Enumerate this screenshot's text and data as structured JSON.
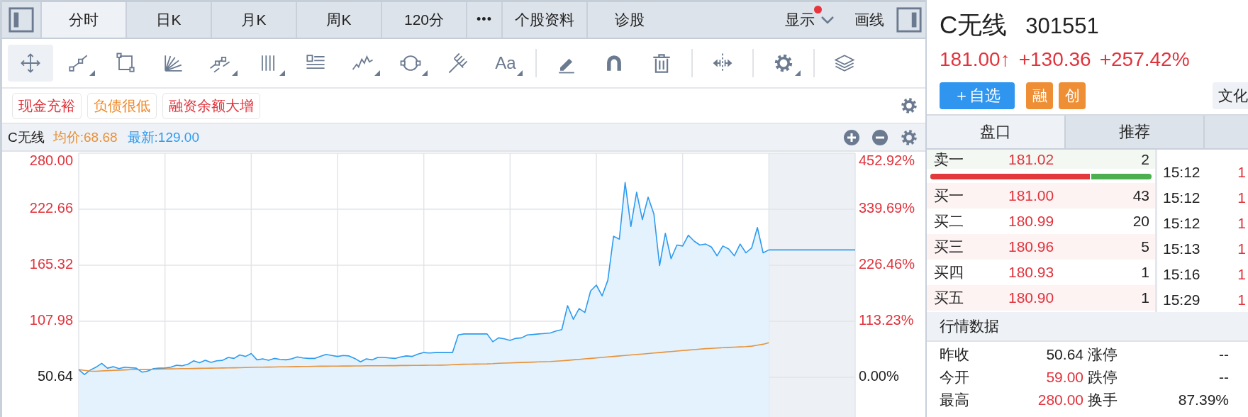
{
  "top_tabs": [
    {
      "label": "分时",
      "selected": true
    },
    {
      "label": "日K",
      "selected": false
    },
    {
      "label": "月K",
      "selected": false
    },
    {
      "label": "周K",
      "selected": false
    },
    {
      "label": "120分",
      "selected": false
    },
    {
      "label": "•••",
      "selected": false
    },
    {
      "label": "个股资料",
      "selected": false
    },
    {
      "label": "诊股",
      "selected": false
    }
  ],
  "display_menu": {
    "label": "显示",
    "notification": true
  },
  "draw_button": {
    "label": "画线"
  },
  "tools": [
    {
      "kind": "move",
      "selected": true,
      "menu": false
    },
    {
      "kind": "line",
      "selected": false,
      "menu": true
    },
    {
      "kind": "rect",
      "selected": false,
      "menu": false
    },
    {
      "kind": "fan",
      "selected": false,
      "menu": false
    },
    {
      "kind": "parallel",
      "selected": false,
      "menu": true
    },
    {
      "kind": "vlines",
      "selected": false,
      "menu": true
    },
    {
      "kind": "glines",
      "selected": false,
      "menu": false
    },
    {
      "kind": "wave",
      "selected": false,
      "menu": true
    },
    {
      "kind": "circle",
      "selected": false,
      "menu": true
    },
    {
      "kind": "fork",
      "selected": false,
      "menu": false
    },
    {
      "kind": "text",
      "label": "Aa",
      "selected": false,
      "menu": true
    },
    {
      "kind": "divider"
    },
    {
      "kind": "pencil",
      "selected": false,
      "menu": false
    },
    {
      "kind": "magnet",
      "selected": false,
      "menu": false
    },
    {
      "kind": "trash",
      "selected": false,
      "menu": false
    },
    {
      "kind": "divider"
    },
    {
      "kind": "split",
      "selected": false,
      "menu": false
    },
    {
      "kind": "divider"
    },
    {
      "kind": "gear",
      "selected": false,
      "menu": true
    },
    {
      "kind": "divider"
    },
    {
      "kind": "layers",
      "selected": false,
      "menu": false
    }
  ],
  "tags": [
    {
      "label": "现金充裕",
      "color": "#e0333c"
    },
    {
      "label": "负债很低",
      "color": "#ef8a2a"
    },
    {
      "label": "融资余额大增",
      "color": "#e0333c"
    }
  ],
  "chart_header": {
    "name": "C无线",
    "average": "均价:68.68",
    "latest": "最新:129.00"
  },
  "chart": {
    "chart_data": {
      "type": "line",
      "grid": true,
      "ylim": [
        9.3,
        280
      ],
      "yticks": [
        {
          "value": 280,
          "label": "280.00"
        },
        {
          "value": 222.66,
          "label": "222.66"
        },
        {
          "value": 165.32,
          "label": "165.32"
        },
        {
          "value": 107.98,
          "label": "107.98"
        },
        {
          "value": 50.64,
          "label": "50.64"
        }
      ],
      "series": [
        {
          "type": "area",
          "color": "#2d9bf0",
          "values": [
            58.6,
            53.5,
            58,
            61,
            65,
            60,
            61.5,
            59.5,
            61,
            60.5,
            60,
            56,
            57,
            59.5,
            60,
            60,
            61,
            63,
            62.5,
            64,
            67.5,
            65.5,
            68,
            66,
            67.5,
            68,
            71,
            70,
            73.5,
            72,
            75,
            68.5,
            69.5,
            68,
            70,
            69,
            68.5,
            69.5,
            71.5,
            70.5,
            70,
            70,
            72,
            74,
            73,
            72,
            73,
            72.5,
            70,
            66.5,
            69.5,
            68.5,
            71,
            71,
            70.5,
            70,
            71.5,
            72.5,
            72,
            74.5,
            76,
            75.5,
            76,
            76,
            76,
            76,
            94,
            95,
            95,
            95,
            95,
            95,
            87,
            91,
            90,
            88.5,
            90.5,
            91,
            94,
            94.5,
            95,
            95.5,
            96,
            98,
            99.5,
            124,
            110,
            121,
            117,
            139,
            145,
            134,
            150,
            195,
            192,
            250,
            205,
            240,
            212,
            235,
            218,
            165,
            198,
            172,
            186,
            185,
            196,
            190,
            186,
            187,
            184,
            175,
            185,
            182,
            175,
            187,
            178,
            183,
            204,
            178,
            181,
            null,
            null,
            null,
            null,
            null,
            null,
            null,
            null,
            null,
            null,
            null,
            null,
            null,
            null,
            null
          ]
        },
        {
          "type": "line",
          "color": "#e8923a",
          "values": [
            58.6,
            57.8,
            57,
            56.8,
            57.2,
            57.5,
            57.8,
            58,
            58.2,
            58.4,
            58.5,
            58.6,
            58.7,
            58.8,
            59,
            59.2,
            59.3,
            59.4,
            59.5,
            59.6,
            59.7,
            59.8,
            59.9,
            60,
            60.1,
            60.2,
            60.3,
            60.4,
            60.5,
            60.6,
            60.8,
            61,
            61,
            61.1,
            61.2,
            61.3,
            61.4,
            61.5,
            61.6,
            61.7,
            61.8,
            61.9,
            62,
            62,
            62.1,
            62.1,
            62.2,
            62.2,
            62.3,
            62.3,
            62.4,
            62.4,
            62.5,
            62.5,
            62.6,
            62.6,
            62.7,
            62.7,
            62.8,
            62.8,
            62.9,
            63,
            63,
            63.1,
            63.2,
            63.5,
            63.8,
            64,
            64.1,
            64.2,
            64.3,
            64.4,
            64.6,
            65,
            65.2,
            65.4,
            65.6,
            65.8,
            66,
            66.2,
            66.4,
            66.6,
            66.8,
            67.2,
            67.6,
            68,
            68.5,
            69,
            69.5,
            70,
            70.5,
            71,
            71.5,
            72,
            72.5,
            73,
            73.5,
            74,
            74.5,
            75,
            75.5,
            76,
            76.5,
            77,
            77.5,
            78,
            78.5,
            79,
            79.5,
            80,
            80.3,
            80.6,
            80.9,
            81.2,
            81.5,
            81.8,
            82.1,
            82.5,
            83.5,
            84.5,
            86,
            null,
            null,
            null,
            null,
            null,
            null,
            null,
            null,
            null,
            null,
            null,
            null,
            null,
            null,
            null
          ]
        },
        {
          "type": "line",
          "color": "#2d9bf0",
          "values": [
            null,
            null,
            null,
            null,
            null,
            null,
            null,
            null,
            null,
            null,
            null,
            null,
            null,
            null,
            null,
            null,
            null,
            null,
            null,
            null,
            null,
            null,
            null,
            null,
            null,
            null,
            null,
            null,
            null,
            null,
            null,
            null,
            null,
            null,
            null,
            null,
            null,
            null,
            null,
            null,
            null,
            null,
            null,
            null,
            null,
            null,
            null,
            null,
            null,
            null,
            null,
            null,
            null,
            null,
            null,
            null,
            null,
            null,
            null,
            null,
            null,
            null,
            null,
            null,
            null,
            null,
            null,
            null,
            null,
            null,
            null,
            null,
            null,
            null,
            null,
            null,
            null,
            null,
            null,
            null,
            null,
            null,
            null,
            null,
            null,
            null,
            null,
            null,
            null,
            null,
            null,
            null,
            null,
            null,
            null,
            null,
            null,
            null,
            null,
            null,
            null,
            null,
            null,
            null,
            null,
            null,
            null,
            null,
            null,
            null,
            null,
            null,
            null,
            null,
            null,
            null,
            null,
            null,
            null,
            null,
            181,
            181,
            181,
            181,
            181,
            181,
            181,
            181,
            181,
            181,
            181,
            181,
            181,
            181,
            181,
            181
          ]
        }
      ]
    },
    "right_axis_labels": [
      "452.92%",
      "339.69%",
      "226.46%",
      "113.23%",
      "0.00%"
    ]
  },
  "quote": {
    "name": "C无线",
    "code": "301551",
    "price": "181.00↑",
    "change": "+130.36",
    "change_pct": "+257.42%",
    "watch_button": "＋自选",
    "badges": [
      "融",
      "创"
    ],
    "sector_tag": "文化"
  },
  "panel_tabs": [
    {
      "label": "盘口",
      "selected": true
    },
    {
      "label": "推荐",
      "selected": false
    }
  ],
  "order_book": {
    "asks": [
      {
        "label": "卖一",
        "price": "181.02",
        "volume": "2"
      }
    ],
    "ratio_bar": {
      "level": 0.72
    },
    "bids": [
      {
        "label": "买一",
        "price": "181.00",
        "volume": "43"
      },
      {
        "label": "买二",
        "price": "180.99",
        "volume": "20"
      },
      {
        "label": "买三",
        "price": "180.96",
        "volume": "5"
      },
      {
        "label": "买四",
        "price": "180.93",
        "volume": "1"
      },
      {
        "label": "买五",
        "price": "180.90",
        "volume": "1"
      }
    ]
  },
  "trades": [
    {
      "time": "15:12",
      "column_2": "1"
    },
    {
      "time": "15:12",
      "column_2": "1"
    },
    {
      "time": "15:12",
      "column_2": "1"
    },
    {
      "time": "15:13",
      "column_2": "1"
    },
    {
      "time": "15:16",
      "column_2": "1"
    },
    {
      "time": "15:29",
      "column_2": "1"
    }
  ],
  "market_data": {
    "title": "行情数据",
    "rows": [
      [
        {
          "label": "昨收",
          "value": "50.64",
          "color": "#222222"
        },
        {
          "label": "涨停",
          "value": "--",
          "color": "#222222"
        }
      ],
      [
        {
          "label": "今开",
          "value": "59.00",
          "color": "#e0333c"
        },
        {
          "label": "跌停",
          "value": "--",
          "color": "#222222"
        }
      ],
      [
        {
          "label": "最高",
          "value": "280.00",
          "color": "#e0333c"
        },
        {
          "label": "换手",
          "value": "87.39%",
          "color": "#222222"
        }
      ]
    ]
  }
}
